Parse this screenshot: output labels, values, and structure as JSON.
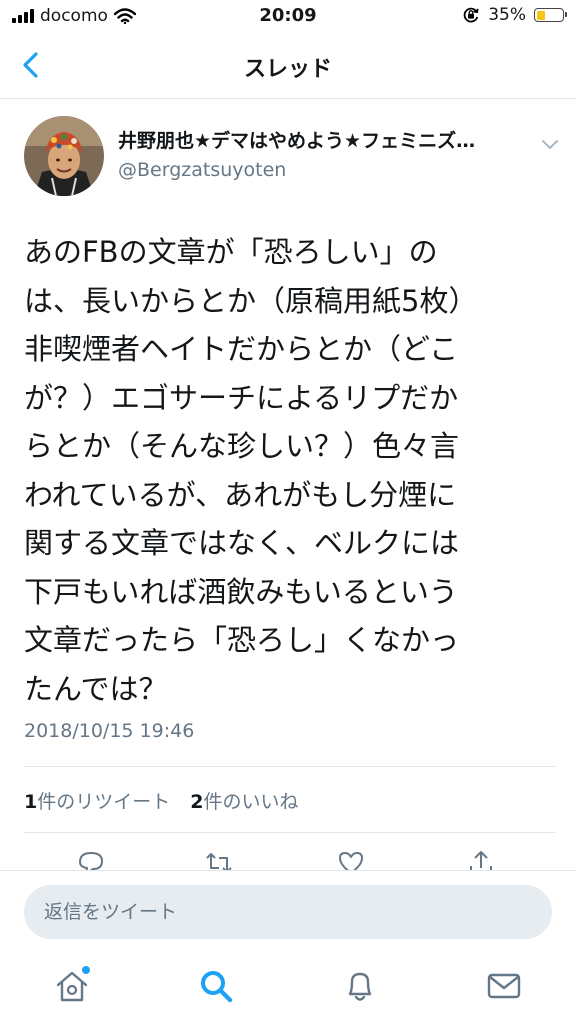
{
  "status_bar": {
    "carrier": "docomo",
    "time": "20:09",
    "battery_percent": "35%",
    "battery_level": 0.35,
    "battery_color": "#f5c518"
  },
  "nav": {
    "back_icon": "chevron-left-icon",
    "title": "スレッド"
  },
  "tweet": {
    "author_name": "井野朋也★デマはやめよう★フェミニズ…",
    "author_handle": "@Bergzatsuyoten",
    "text_lines": [
      "あのFBの文章が「恐ろしい」の",
      "は、長いからとか（原稿用紙5枚）",
      "非喫煙者ヘイトだからとか（どこ",
      "が？）エゴサーチによるリプだか",
      "らとか（そんな珍しい？）色々言",
      "われているが、あれがもし分煙に",
      "関する文章ではなく、ベルクには",
      "下戸もいれば酒飲みもいるという",
      "文章だったら「恐ろし」くなかっ",
      "たんでは？"
    ],
    "timestamp": "2018/10/15 19:46",
    "retweet_count": "1",
    "retweet_label": "件のリツイート",
    "like_count": "2",
    "like_label": "件のいいね"
  },
  "actions": [
    "reply-icon",
    "retweet-icon",
    "like-icon",
    "share-icon"
  ],
  "reply_bar": {
    "placeholder": "返信をツイート"
  },
  "tab_bar": [
    "home-icon",
    "search-icon",
    "notifications-icon",
    "messages-icon"
  ],
  "colors": {
    "accent": "#1da1f2",
    "secondary_text": "#657786",
    "divider": "#e1e8ed",
    "input_bg": "#e6ecf0"
  }
}
